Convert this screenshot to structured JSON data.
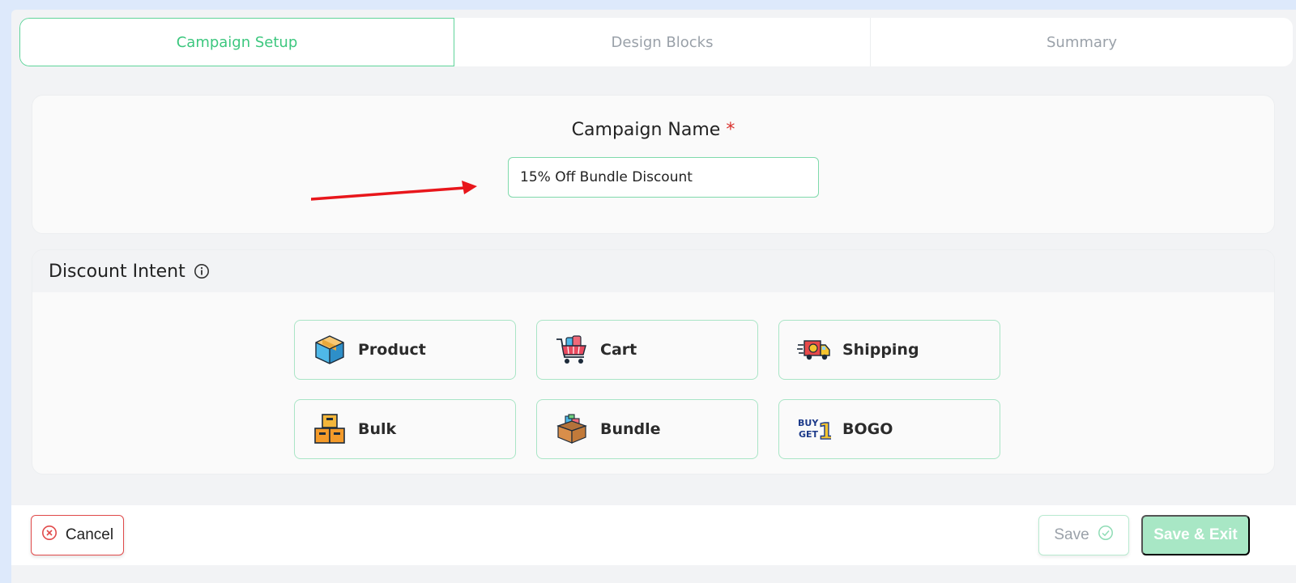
{
  "stepper": {
    "steps": [
      {
        "label": "Campaign Setup",
        "active": true
      },
      {
        "label": "Design Blocks",
        "active": false
      },
      {
        "label": "Summary",
        "active": false
      }
    ]
  },
  "campaign": {
    "label": "Campaign Name",
    "required_mark": "*",
    "value": "15% Off Bundle Discount"
  },
  "intent": {
    "title": "Discount Intent",
    "options": [
      {
        "label": "Product",
        "icon": "box-icon"
      },
      {
        "label": "Cart",
        "icon": "shopping-cart-icon"
      },
      {
        "label": "Shipping",
        "icon": "delivery-truck-icon"
      },
      {
        "label": "Bulk",
        "icon": "stacked-boxes-icon"
      },
      {
        "label": "Bundle",
        "icon": "bundle-box-icon"
      },
      {
        "label": "BOGO",
        "icon": "buy-get-one-icon",
        "icon_text": [
          "BUY",
          "GET",
          "1"
        ]
      }
    ]
  },
  "footer": {
    "cancel_label": "Cancel",
    "save_label": "Save",
    "save_exit_label": "Save & Exit"
  },
  "colors": {
    "accent": "#3cc77e",
    "danger": "#e14b4b",
    "annotation_arrow": "#e8161b"
  }
}
